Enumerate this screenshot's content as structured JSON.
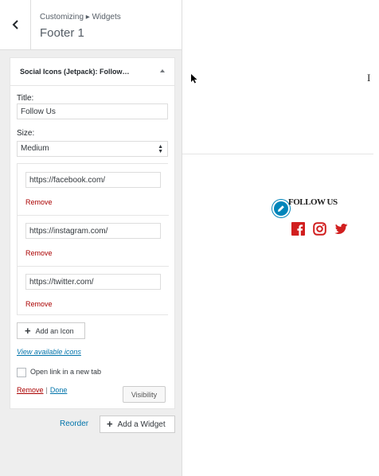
{
  "header": {
    "breadcrumb": "Customizing ▸ Widgets",
    "title": "Footer 1"
  },
  "widget": {
    "title": "Social Icons (Jetpack): Follow…",
    "title_label": "Title:",
    "title_value": "Follow Us",
    "size_label": "Size:",
    "size_value": "Medium",
    "icons": [
      {
        "url": "https://facebook.com/",
        "remove": "Remove"
      },
      {
        "url": "https://instagram.com/",
        "remove": "Remove"
      },
      {
        "url": "https://twitter.com/",
        "remove": "Remove"
      }
    ],
    "add_icon": "Add an Icon",
    "view_icons": "View available icons",
    "new_tab_label": "Open link in a new tab",
    "new_tab_checked": false,
    "remove": "Remove",
    "separator": "|",
    "done": "Done",
    "visibility": "Visibility"
  },
  "footer": {
    "reorder": "Reorder",
    "add_widget": "Add a Widget"
  },
  "preview": {
    "heading": "FOLLOW US",
    "text_cursor": "I",
    "social_icons": [
      "facebook-icon",
      "instagram-icon",
      "twitter-icon"
    ],
    "social_color": "#d11f1f",
    "edit_color": "#0085ba"
  }
}
